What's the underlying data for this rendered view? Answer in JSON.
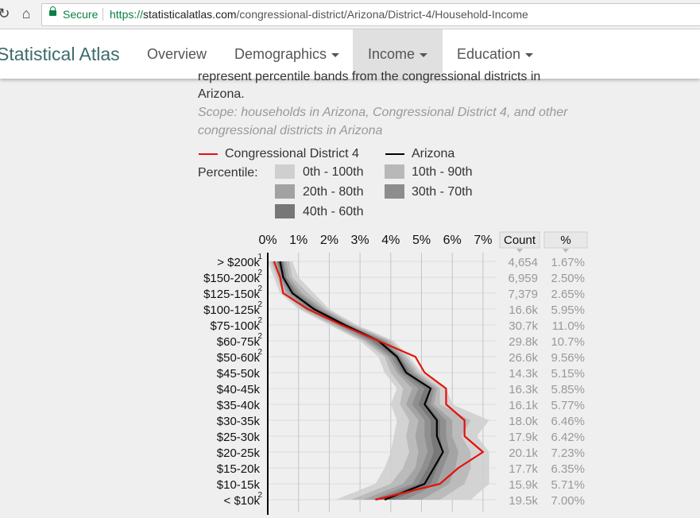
{
  "browser": {
    "secure_label": "Secure",
    "url_scheme": "https://",
    "url_host": "statisticalatlas.com",
    "url_path": "/congressional-district/Arizona/District-4/Household-Income"
  },
  "site": {
    "brand": "Statistical Atlas",
    "nav": [
      {
        "label": "Overview",
        "dropdown": false,
        "active": false
      },
      {
        "label": "Demographics",
        "dropdown": true,
        "active": false
      },
      {
        "label": "Income",
        "dropdown": true,
        "active": true
      },
      {
        "label": "Education",
        "dropdown": true,
        "active": false
      }
    ]
  },
  "text": {
    "partial_line": "represent percentile bands from the congressional districts in",
    "line2": "Arizona.",
    "scope_line1": "Scope: households in Arizona, Congressional District 4, and other",
    "scope_line2": "congressional districts in Arizona"
  },
  "legend": {
    "district": "Congressional District 4",
    "state": "Arizona",
    "percentile_label": "Percentile:",
    "bands": [
      "0th - 100th",
      "10th - 90th",
      "20th - 80th",
      "30th - 70th",
      "40th - 60th"
    ],
    "district_color": "#e3120b",
    "state_color": "#000000"
  },
  "chart_data": {
    "type": "line",
    "orientation": "horizontal",
    "x_ticks": [
      "0%",
      "1%",
      "2%",
      "3%",
      "4%",
      "5%",
      "6%",
      "7%"
    ],
    "xlim": [
      0,
      7.5
    ],
    "count_header": "Count",
    "pct_header": "%",
    "categories": [
      "> $200k",
      "$150-200k",
      "$125-150k",
      "$100-125k",
      "$75-100k",
      "$60-75k",
      "$50-60k",
      "$45-50k",
      "$40-45k",
      "$35-40k",
      "$30-35k",
      "$25-30k",
      "$20-25k",
      "$15-20k",
      "$10-15k",
      "< $10k"
    ],
    "superscripts": [
      "1",
      "2",
      "2",
      "2",
      "2",
      "2",
      "2",
      "",
      "",
      "",
      "",
      "",
      "",
      "",
      "",
      "2"
    ],
    "counts": [
      "4,654",
      "6,959",
      "7,379",
      "16.6k",
      "30.7k",
      "29.8k",
      "26.6k",
      "14.3k",
      "16.3k",
      "16.1k",
      "18.0k",
      "17.9k",
      "20.1k",
      "17.7k",
      "15.9k",
      "19.5k"
    ],
    "pcts": [
      "1.67%",
      "2.50%",
      "2.65%",
      "5.95%",
      "11.0%",
      "10.7%",
      "9.56%",
      "5.15%",
      "5.85%",
      "5.77%",
      "6.46%",
      "6.42%",
      "7.23%",
      "6.35%",
      "5.71%",
      "7.00%"
    ],
    "series": [
      {
        "name": "Congressional District 4",
        "color": "#e3120b",
        "values": [
          0.2,
          0.4,
          0.5,
          1.3,
          2.4,
          3.6,
          4.8,
          5.1,
          5.8,
          5.8,
          6.4,
          6.4,
          7.0,
          6.2,
          5.6,
          3.5
        ]
      },
      {
        "name": "Arizona",
        "color": "#000000",
        "values": [
          0.4,
          0.5,
          0.8,
          1.5,
          2.5,
          3.6,
          4.2,
          4.5,
          5.3,
          5.1,
          5.5,
          5.5,
          5.7,
          5.4,
          5.1,
          3.8
        ]
      }
    ],
    "bands": [
      {
        "name": "0th - 100th",
        "color": "#cfcfcf",
        "low": [
          0.0,
          0.2,
          0.4,
          1.0,
          2.0,
          3.0,
          3.6,
          3.8,
          4.2,
          4.0,
          4.2,
          4.1,
          4.0,
          3.8,
          3.5,
          2.2
        ],
        "high": [
          0.8,
          1.0,
          1.5,
          2.0,
          2.9,
          4.1,
          4.6,
          5.0,
          5.8,
          6.0,
          7.2,
          6.8,
          7.2,
          7.2,
          7.2,
          6.6
        ]
      },
      {
        "name": "10th - 90th",
        "color": "#b8b8b8",
        "low": [
          0.1,
          0.3,
          0.5,
          1.1,
          2.1,
          3.1,
          3.8,
          4.0,
          4.4,
          4.3,
          4.6,
          4.5,
          4.6,
          4.4,
          4.0,
          2.7
        ],
        "high": [
          0.7,
          0.8,
          1.3,
          1.9,
          2.8,
          4.0,
          4.5,
          4.9,
          5.6,
          5.6,
          6.6,
          6.3,
          6.6,
          6.6,
          6.4,
          5.6
        ]
      },
      {
        "name": "20th - 80th",
        "color": "#a2a2a2",
        "low": [
          0.2,
          0.4,
          0.6,
          1.2,
          2.2,
          3.2,
          3.9,
          4.2,
          4.7,
          4.5,
          4.9,
          4.8,
          4.9,
          4.8,
          4.4,
          3.1
        ],
        "high": [
          0.6,
          0.7,
          1.1,
          1.8,
          2.7,
          3.9,
          4.4,
          4.8,
          5.5,
          5.4,
          6.0,
          6.0,
          6.2,
          6.1,
          5.9,
          5.0
        ]
      },
      {
        "name": "30th - 70th",
        "color": "#8d8d8d",
        "low": [
          0.3,
          0.4,
          0.7,
          1.3,
          2.3,
          3.3,
          4.0,
          4.3,
          4.9,
          4.7,
          5.1,
          5.1,
          5.2,
          5.0,
          4.7,
          3.4
        ],
        "high": [
          0.5,
          0.6,
          1.0,
          1.7,
          2.6,
          3.8,
          4.3,
          4.7,
          5.4,
          5.3,
          5.8,
          5.8,
          5.9,
          5.7,
          5.5,
          4.5
        ]
      },
      {
        "name": "40th - 60th",
        "color": "#777777",
        "low": [
          0.3,
          0.5,
          0.8,
          1.4,
          2.4,
          3.4,
          4.1,
          4.4,
          5.1,
          4.9,
          5.3,
          5.3,
          5.4,
          5.2,
          4.9,
          3.6
        ],
        "high": [
          0.5,
          0.6,
          0.9,
          1.6,
          2.6,
          3.7,
          4.3,
          4.6,
          5.3,
          5.2,
          5.6,
          5.6,
          5.7,
          5.5,
          5.3,
          4.1
        ]
      }
    ]
  }
}
